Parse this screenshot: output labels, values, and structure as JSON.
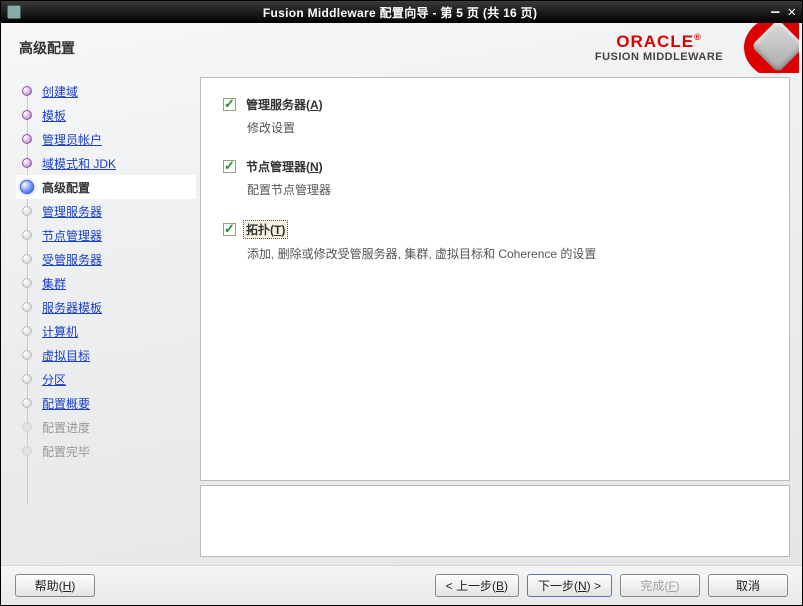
{
  "window": {
    "title": "Fusion Middleware 配置向导 - 第 5 页 (共 16 页)"
  },
  "header": {
    "page_title": "高级配置",
    "logo_brand": "ORACLE",
    "logo_sub": "FUSION MIDDLEWARE"
  },
  "sidebar": {
    "items": [
      {
        "label": "创建域",
        "state": "done"
      },
      {
        "label": "模板",
        "state": "done"
      },
      {
        "label": "管理员帐户",
        "state": "done"
      },
      {
        "label": "域模式和 JDK",
        "state": "done"
      },
      {
        "label": "高级配置",
        "state": "current"
      },
      {
        "label": "管理服务器",
        "state": "todo"
      },
      {
        "label": "节点管理器",
        "state": "todo"
      },
      {
        "label": "受管服务器",
        "state": "todo"
      },
      {
        "label": "集群",
        "state": "todo"
      },
      {
        "label": "服务器模板",
        "state": "todo"
      },
      {
        "label": "计算机",
        "state": "todo"
      },
      {
        "label": "虚拟目标",
        "state": "todo"
      },
      {
        "label": "分区",
        "state": "todo"
      },
      {
        "label": "配置概要",
        "state": "todo"
      },
      {
        "label": "配置进度",
        "state": "disabled"
      },
      {
        "label": "配置完毕",
        "state": "disabled"
      }
    ]
  },
  "options": [
    {
      "label_pre": "管理服务器(",
      "label_u": "A",
      "label_post": ")",
      "desc": "修改设置",
      "checked": true,
      "focused": false
    },
    {
      "label_pre": "节点管理器(",
      "label_u": "N",
      "label_post": ")",
      "desc": "配置节点管理器",
      "checked": true,
      "focused": false
    },
    {
      "label_pre": "拓扑(",
      "label_u": "T",
      "label_post": ")",
      "desc": "添加, 删除或修改受管服务器, 集群, 虚拟目标和 Coherence 的设置",
      "checked": true,
      "focused": true
    }
  ],
  "footer": {
    "help": "帮助(H)",
    "back": "< 上一步(B)",
    "next": "下一步(N) >",
    "finish": "完成(F)",
    "cancel": "取消"
  }
}
